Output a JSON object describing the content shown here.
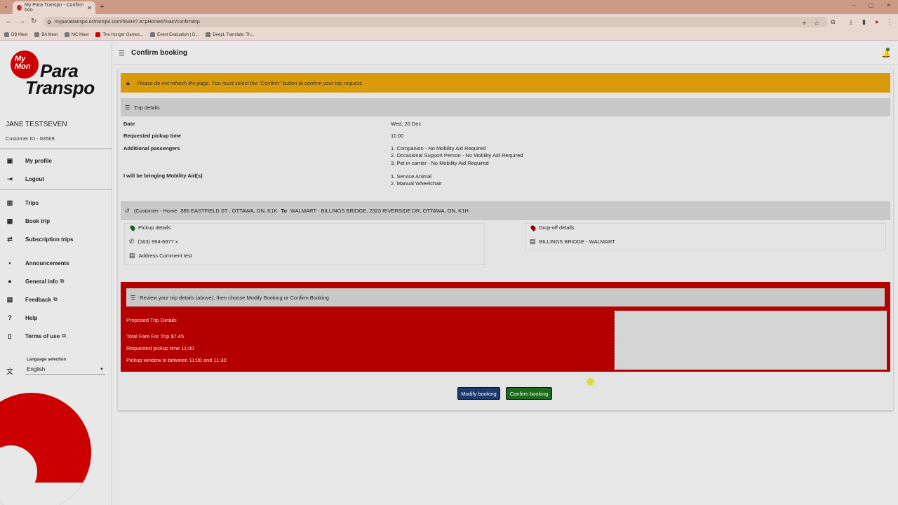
{
  "browser": {
    "tab_title": "My Para Transpo - Confirm boo",
    "url": "myparatranspo.octranspo.com/hiwire?.a=pHome#/main/confirmtrip",
    "bookmarks": [
      "DB Meet",
      "BA Meet",
      "MC Meet",
      "The Hunger Games...",
      "Event Evaluation | D...",
      "DeepL Translate: Th..."
    ]
  },
  "sidebar": {
    "logo_my": "My",
    "logo_mon": "Mon",
    "logo_para": "Para",
    "logo_transpo": "Transpo",
    "user_name": "JANE TESTSEVEN",
    "customer_id": "Customer ID - 93569",
    "account_items": [
      {
        "label": "My profile",
        "icon": "profile-icon"
      },
      {
        "label": "Logout",
        "icon": "logout-icon"
      }
    ],
    "nav_items": [
      {
        "label": "Trips",
        "icon": "map-icon"
      },
      {
        "label": "Book trip",
        "icon": "calendar-icon"
      },
      {
        "label": "Subscription trips",
        "icon": "repeat-icon"
      },
      {
        "label": "Announcements",
        "icon": "announcement-icon"
      },
      {
        "label": "General info",
        "icon": "info-icon"
      },
      {
        "label": "Feedback",
        "icon": "feedback-icon"
      },
      {
        "label": "Help",
        "icon": "help-icon"
      },
      {
        "label": "Terms of use",
        "icon": "document-icon"
      }
    ],
    "language_label": "Language selection",
    "language_value": "English"
  },
  "header": {
    "title": "Confirm booking"
  },
  "warning": "Please do not refresh the page. You must select the \"Confirm\" button to confirm your trip request.",
  "trip_details": {
    "heading": "Trip details",
    "date_label": "Date",
    "date_value": "Wed, 20 Dec",
    "pickup_label": "Requested pickup time",
    "pickup_value": "11:00",
    "passengers_label": "Additional passengers",
    "passengers": [
      "1. Companion - No Mobility Aid Required",
      "2. Occasional Support Person - No Mobility Aid Required",
      "3. Pet in carrier - No Mobility Aid Required"
    ],
    "aids_label": "I will be bringing Mobility Aid(s)",
    "aids": [
      "1. Service Animal",
      "2. Manual Wheelchair"
    ]
  },
  "route": {
    "from_label": "(Customer - Home",
    "from_address": "886 EASTFIELD ST , OTTAWA, ON, K1K",
    "to_word": "To",
    "to_address": "WALMART - BILLINGS BRIDGE, 2323 RIVERSIDE DR, OTTAWA, ON, K1H"
  },
  "pickup": {
    "title": "Pickup details",
    "phone": "(163) 994-6977 x",
    "comment": "Address Comment test"
  },
  "dropoff": {
    "title": "Drop-off details",
    "comment": "BILLINGS BRIDGE - WALMART"
  },
  "review": {
    "instruction": "Review your trip details (above), then choose Modify Booking or Confirm Booking",
    "proposed_title": "Proposed Trip Details",
    "fare": "Total Fare For Trip $7.45",
    "pickup_time": "Requested pickup time 11:00",
    "window": "Pickup window is between 11:00 and 11:30"
  },
  "buttons": {
    "modify": "Modify booking",
    "confirm": "Confirm booking"
  },
  "colors": {
    "warning": "#d99a0b",
    "review_panel": "#b50000",
    "modify_button": "#1c3a6e",
    "confirm_button": "#1c6a1c",
    "brand_red": "#cc0000"
  }
}
